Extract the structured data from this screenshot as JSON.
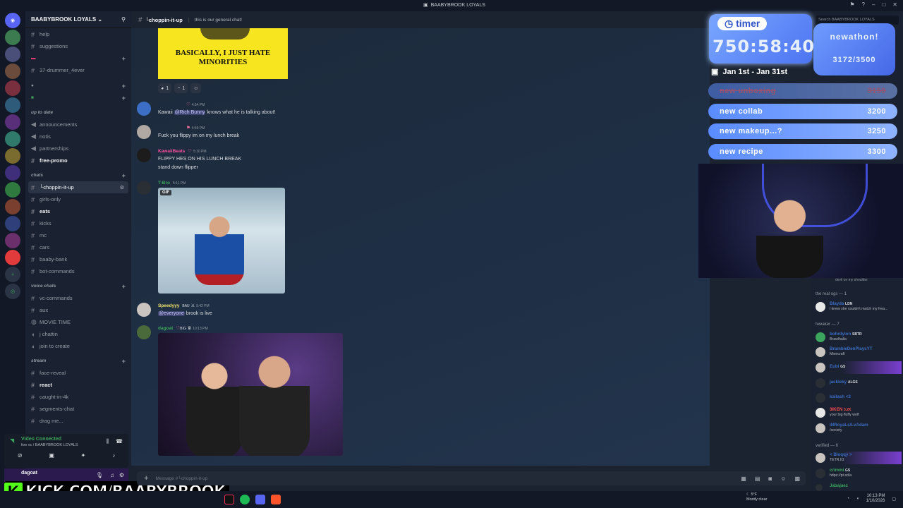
{
  "window": {
    "title": "BAABYBROOK LOYALS"
  },
  "server": {
    "name": "BAABYBROOK LOYALS"
  },
  "channels": {
    "top": [
      {
        "label": "help"
      },
      {
        "label": "suggestions"
      }
    ],
    "drummer": "37-drummer_4ever",
    "up_to_date_cat": "up to date",
    "up_to_date": [
      {
        "label": "announcements"
      },
      {
        "label": "notis"
      },
      {
        "label": "partnerships"
      },
      {
        "label": "free-promo"
      }
    ],
    "chats_cat": "chats",
    "chats": [
      {
        "label": "└choppin-it-up"
      },
      {
        "label": "girls-only"
      },
      {
        "label": "eats"
      },
      {
        "label": "kicks"
      },
      {
        "label": "mc"
      },
      {
        "label": "cars"
      },
      {
        "label": "baaby-bank"
      },
      {
        "label": "bot-commands"
      }
    ],
    "voice_cat": "voice chats",
    "voice": [
      {
        "label": "vc-commands"
      },
      {
        "label": "aux"
      },
      {
        "label": "MOVIE TIME"
      },
      {
        "label": "j chattin"
      },
      {
        "label": "join to create"
      }
    ],
    "stream_cat": "stream",
    "stream": [
      {
        "label": "face-reveal"
      },
      {
        "label": "react"
      },
      {
        "label": "caught-in-4k"
      },
      {
        "label": "segments-chat"
      },
      {
        "label": "drag me..."
      }
    ]
  },
  "voice_status": {
    "title": "Video Connected",
    "sub": "live vc / BAABYBROOK LOYALS"
  },
  "user": {
    "name": "dagoat"
  },
  "overlay": {
    "kick_url": "KICK.COM/BAABYBROOK",
    "timer_label": "timer",
    "timer_value": "750:58:40",
    "newathon_title": "newathon!",
    "newathon_progress": "3172/3500",
    "date_range": "Jan 1st - Jan 31st"
  },
  "goals": [
    {
      "label": "new unboxing",
      "value": "3150",
      "done": true
    },
    {
      "label": "new collab",
      "value": "3200"
    },
    {
      "label": "new makeup...?",
      "value": "3250"
    },
    {
      "label": "new recipe",
      "value": "3300"
    }
  ],
  "header": {
    "channel": "└choppin-it-up",
    "topic": "this is our general chat!"
  },
  "meme": {
    "text": "BASICALLY, I JUST HATE MINORITIES"
  },
  "reactions": [
    {
      "count": "1"
    },
    {
      "count": "1"
    }
  ],
  "messages": [
    {
      "time": "4:54 PM",
      "pre": "Kawaii",
      "mention": "@Rich Bunny",
      "post": " knows what he is talking about!"
    },
    {
      "time": "4:59 PM",
      "text": "Fuck you flippy im on my lunch break"
    },
    {
      "user": "KawaiiBeats",
      "time": "5:10 PM",
      "l1": "FLIPPY HES ON HIS LUNCH BREAK",
      "l2": "stand down flipper"
    },
    {
      "user": "T-Bro",
      "time": "5:11 PM",
      "gif": "GIF"
    },
    {
      "user": "Speedyyy",
      "tag": "BAU",
      "time": "9:42 PM",
      "mention": "@everyone",
      "post": " brook is live"
    },
    {
      "user": "dagoat",
      "tag": "BIG",
      "time": "10:13 PM"
    }
  ],
  "composer": {
    "placeholder": "Message #└choppin-it-up"
  },
  "members": {
    "search": "Search BAABYBROOK LOYALS",
    "top_status": "devil on my shoulder",
    "group_real": "the real ogs — 1",
    "real": [
      {
        "name": "Blayda",
        "tag": "LDN",
        "status": "i knew she couldn't match my frea..."
      }
    ],
    "group_tweaker": "tweaker — 7",
    "tweaker": [
      {
        "name": "bohrdylon",
        "tag": "SBTR",
        "status": "Brawlhalla"
      },
      {
        "name": "BrambleDenPlaysYT",
        "status": "Minecraft"
      },
      {
        "name": "Eubi",
        "tag": "GS",
        "status": ""
      },
      {
        "name": "jackieky",
        "tag": "ALGS",
        "status": ""
      },
      {
        "name": "kailash <3",
        "status": ""
      },
      {
        "name": "3IKEN",
        "tag": "3.2K",
        "status": "your big fluffy wolf"
      },
      {
        "name": "iNRoyaLs/LvAdam",
        "status": "/society"
      }
    ],
    "group_verified": "verified — 6",
    "verified": [
      {
        "name": "< Bloqqy >",
        "status": "TETR.IO"
      },
      {
        "name": "crimmi",
        "tag": "GS",
        "status": "https://pt.sd/a"
      },
      {
        "name": "Jabajaez",
        "status": ""
      }
    ]
  },
  "taskbar": {
    "weather_temp": "5°F",
    "weather_desc": "Mostly clear",
    "time": "10:13 PM",
    "date": "1/10/2026"
  },
  "colors": {
    "accent": "#4c74f2",
    "kick": "#53fc18",
    "mention": "#3c4270"
  }
}
